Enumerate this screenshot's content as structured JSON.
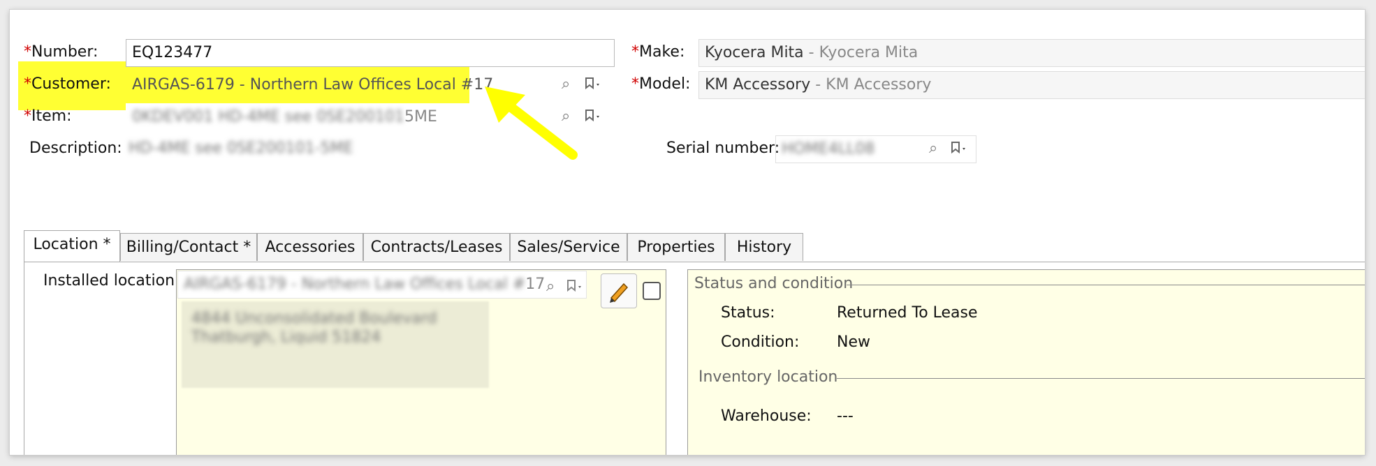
{
  "header": {
    "number": {
      "label": "Number:",
      "value": "EQ123477"
    },
    "customer": {
      "label": "Customer:",
      "value": "AIRGAS-6179 - Northern Law Offices Local #17"
    },
    "item": {
      "label": "Item:",
      "code": "0KDEV001",
      "desc_blurred": "HD-4ME see 0SE200101",
      "desc_tail": "5ME"
    },
    "description": {
      "label": "Description:",
      "value": "HD-4ME see 0SE200101-5ME"
    },
    "make": {
      "label": "Make:",
      "value": "Kyocera Mita",
      "sub": " - Kyocera Mita"
    },
    "model": {
      "label": "Model:",
      "value": "KM Accessory",
      "sub": " - KM Accessory"
    },
    "serial": {
      "label": "Serial number:",
      "value": "HOME4LL08"
    },
    "required_marker": "*"
  },
  "tabs": [
    {
      "label": "Location *"
    },
    {
      "label": "Billing/Contact *"
    },
    {
      "label": "Accessories"
    },
    {
      "label": "Contracts/Leases"
    },
    {
      "label": "Sales/Service"
    },
    {
      "label": "Properties"
    },
    {
      "label": "History"
    }
  ],
  "location": {
    "installed_label": "Installed location:",
    "installed_blurred": "AIRGAS-6179 - Northern Law Offices Local #",
    "installed_tail": "17",
    "address_line1": "4844 Unconsolidated Boulevard",
    "address_line2": "Thatburgh, Liquid 51824"
  },
  "status_panel": {
    "section_title": "Status and condition",
    "status_label": "Status:",
    "status_value": "Returned To Lease",
    "condition_label": "Condition:",
    "condition_value": "New",
    "inventory_title": "Inventory location",
    "warehouse_label": "Warehouse:",
    "warehouse_value": "---"
  },
  "colors": {
    "highlight": "#ffff33",
    "arrow": "#ffff00",
    "panel_bg": "#ffffe6",
    "required": "#d00000"
  },
  "icons": [
    "search-icon",
    "bookmark-dropdown-icon",
    "pencil-icon"
  ]
}
